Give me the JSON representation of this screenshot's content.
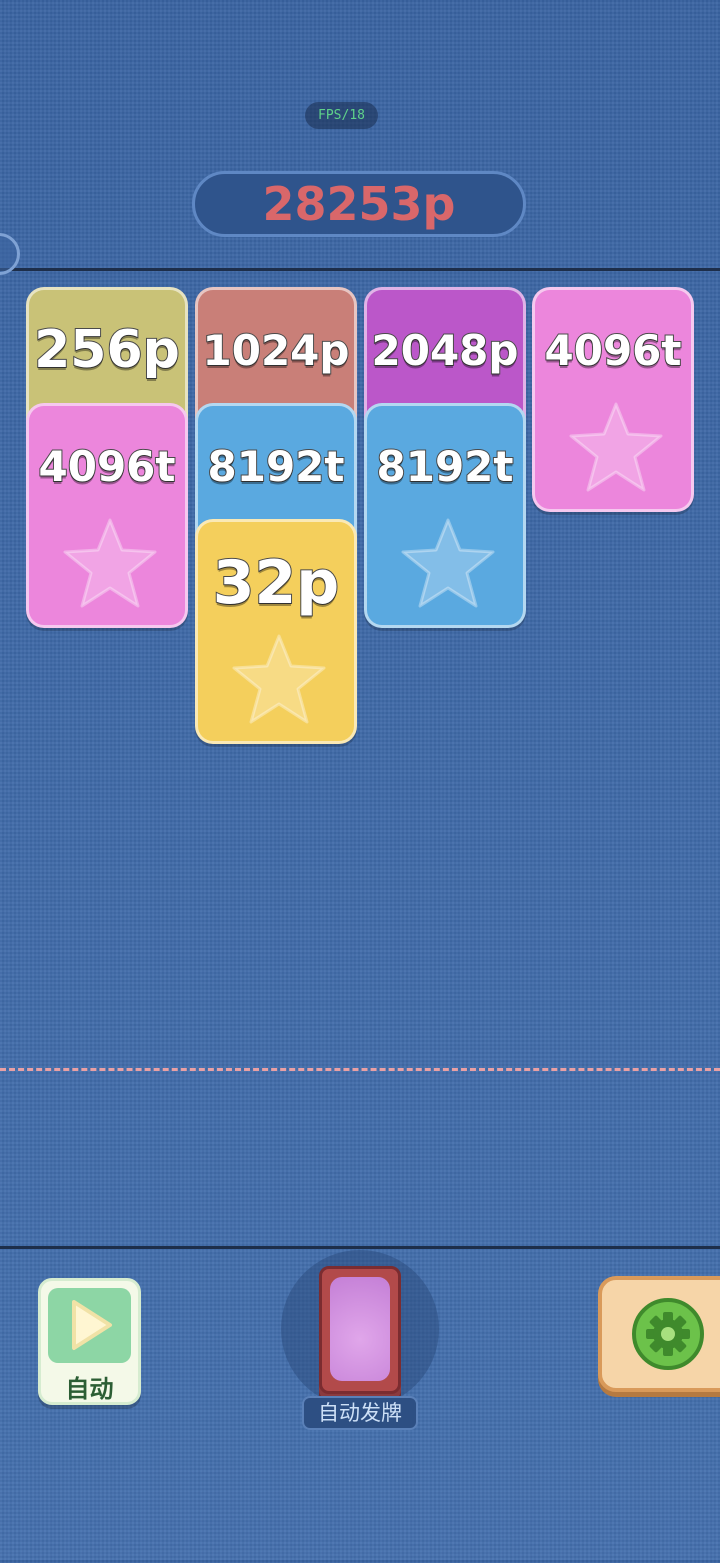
{
  "hud": {
    "fps": "FPS/18",
    "score": "28253p"
  },
  "board": {
    "cards": [
      {
        "value": "256p",
        "color": "#c9c277",
        "column": 1,
        "row": 1
      },
      {
        "value": "1024p",
        "color": "#c97f78",
        "column": 2,
        "row": 1
      },
      {
        "value": "2048p",
        "color": "#bb57c9",
        "column": 3,
        "row": 1
      },
      {
        "value": "4096t",
        "color": "#ec86dc",
        "column": 4,
        "row": 1
      },
      {
        "value": "4096t",
        "color": "#ec86dc",
        "column": 1,
        "row": 2
      },
      {
        "value": "8192t",
        "color": "#5aa9e0",
        "column": 2,
        "row": 2
      },
      {
        "value": "8192t",
        "color": "#5aa9e0",
        "column": 3,
        "row": 2
      },
      {
        "value": "32p",
        "color": "#f4cf5c",
        "column": 2,
        "row": 3
      }
    ]
  },
  "controls": {
    "auto_label": "自动",
    "deal_label": "自动发牌",
    "settings_icon": "gear-icon",
    "auto_icon": "play-icon"
  },
  "colors": {
    "background": "#3f6aa7",
    "score_text": "#d9676a",
    "dead_line": "#e9a0a4"
  }
}
